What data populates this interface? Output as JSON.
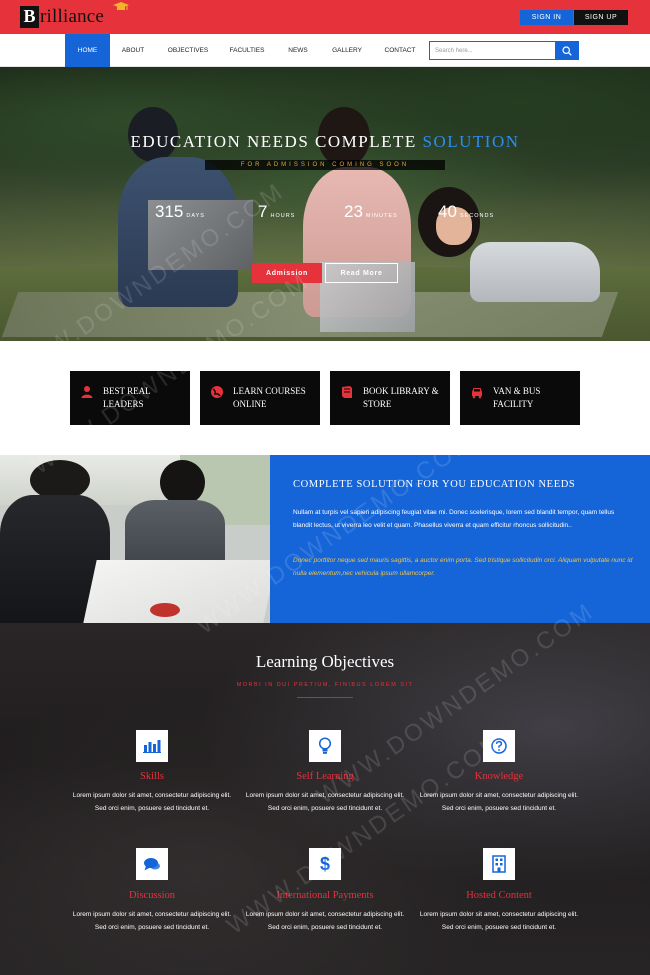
{
  "brand": {
    "logo_initial": "B",
    "logo_rest": "rilliance"
  },
  "auth": {
    "signin": "SIGN IN",
    "signup": "SIGN UP"
  },
  "nav": {
    "items": [
      "HOME",
      "ABOUT",
      "OBJECTIVES",
      "FACULTIES",
      "NEWS",
      "GALLERY",
      "CONTACT"
    ],
    "active": "HOME",
    "search_placeholder": "Search here..."
  },
  "hero": {
    "title_main": "EDUCATION NEEDS COMPLETE",
    "title_accent": "SOLUTION",
    "subtitle": "FOR ADMISSION COMING SOON",
    "countdown": [
      {
        "value": "315",
        "unit": "DAYS"
      },
      {
        "value": "7",
        "unit": "HOURS"
      },
      {
        "value": "23",
        "unit": "MINUTES"
      },
      {
        "value": "40",
        "unit": "SECONDS"
      }
    ],
    "btn_admission": "Admission",
    "btn_readmore": "Read More"
  },
  "features": [
    {
      "label": "BEST REAL LEADERS",
      "icon": "user-icon"
    },
    {
      "label": "LEARN COURSES ONLINE",
      "icon": "globe-icon"
    },
    {
      "label": "BOOK LIBRARY & STORE",
      "icon": "book-icon"
    },
    {
      "label": "VAN & BUS FACILITY",
      "icon": "car-icon"
    }
  ],
  "about": {
    "title": "COMPLETE SOLUTION FOR YOU EDUCATION NEEDS",
    "p1": "Nullam at turpis vel sapien adipiscing feugiat vitae mi. Donec scelerisque, lorem sed blandit tempor, quam tellus blandit lectus, ut viverra leo velit et quam. Phasellus viverra et quam efficitur rhoncus sollicitudin..",
    "p2": "Donec porttitor neque sed mauris sagittis, a auctor enim porta. Sed tristique sollicitudin orci. Aliquam vulputate nunc id nulla elementum,nec vehicula ipsum ullamcorper."
  },
  "objectives": {
    "title": "Learning Objectives",
    "subtitle": "MORBI IN DUI PRETIUM, FINIBUS LOREM SIT",
    "items": [
      {
        "name": "Skills",
        "icon": "bar-chart-icon",
        "text": "Lorem ipsum dolor sit amet, consectetur adipiscing elit. Sed orci enim, posuere sed tincidunt et."
      },
      {
        "name": "Self Learning",
        "icon": "lightbulb-icon",
        "text": "Lorem ipsum dolor sit amet, consectetur adipiscing elit. Sed orci enim, posuere sed tincidunt et."
      },
      {
        "name": "Knowledge",
        "icon": "question-icon",
        "text": "Lorem ipsum dolor sit amet, consectetur adipiscing elit. Sed orci enim, posuere sed tincidunt et."
      },
      {
        "name": "Discussion",
        "icon": "chat-icon",
        "text": "Lorem ipsum dolor sit amet, consectetur adipiscing elit. Sed orci enim, posuere sed tincidunt et."
      },
      {
        "name": "International Payments",
        "icon": "dollar-icon",
        "text": "Lorem ipsum dolor sit amet, consectetur adipiscing elit. Sed orci enim, posuere sed tincidunt et."
      },
      {
        "name": "Hosted Content",
        "icon": "building-icon",
        "text": "Lorem ipsum dolor sit amet, consectetur adipiscing elit. Sed orci enim, posuere sed tincidunt et."
      }
    ]
  },
  "watermark": "WWW.DOWNDEMO.COM",
  "colors": {
    "brand_red": "#e5323b",
    "brand_blue": "#1565d8",
    "accent_gold": "#e8a33a"
  }
}
